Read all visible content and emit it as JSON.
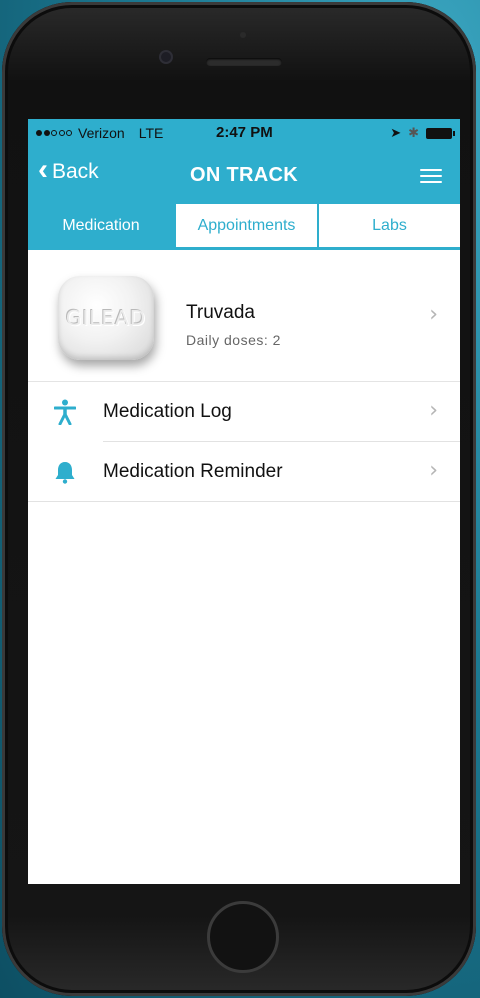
{
  "status_bar": {
    "carrier": "Verizon",
    "network": "LTE",
    "time": "2:47 PM"
  },
  "nav": {
    "back_label": "Back",
    "title": "ON TRACK"
  },
  "tabs": [
    {
      "label": "Medication",
      "active": true
    },
    {
      "label": "Appointments",
      "active": false
    },
    {
      "label": "Labs",
      "active": false
    }
  ],
  "medication": {
    "name": "Truvada",
    "doses_label": "Daily doses: 2",
    "pill_imprint": "GILEAD"
  },
  "menu_items": [
    {
      "label": "Medication Log",
      "icon": "person-icon"
    },
    {
      "label": "Medication Reminder",
      "icon": "bell-icon"
    }
  ],
  "colors": {
    "accent": "#2eaecd",
    "background": "#1f7f98"
  }
}
